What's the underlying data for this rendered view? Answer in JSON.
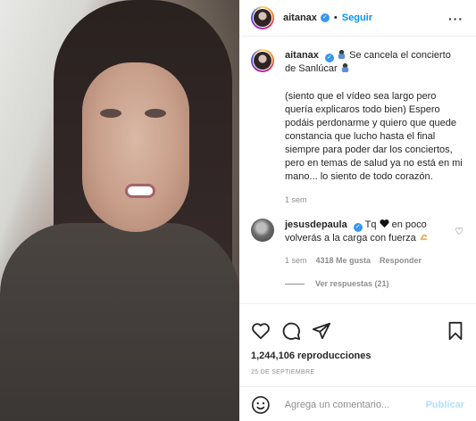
{
  "post": {
    "username": "aitanax",
    "follow_label": "Seguir",
    "more_label": "···"
  },
  "caption": {
    "username": "aitanax",
    "title_text": " Se cancela el concierto de Sanlúcar",
    "body": "(siento que el vídeo sea largo pero quería explicaros todo bien) Espero podáis perdonarme y quiero que quede constancia que lucho hasta el final siempre para poder dar los conciertos, pero en temas de salud ya no está en mi mano... lo siento de todo corazón.",
    "time": "1 sem"
  },
  "comment": {
    "username": "jesusdepaula",
    "text_before": " Tq ",
    "text_after": " en poco volverás a la carga con fuerza ",
    "time": "1 sem",
    "likes": "4318 Me gusta",
    "reply_label": "Responder",
    "view_replies": "Ver respuestas (21)"
  },
  "stats": {
    "views": "1,244,106 reproducciones",
    "date": "25 DE SEPTIEMBRE"
  },
  "add_comment": {
    "placeholder": "Agrega un comentario...",
    "publish_label": "Publicar"
  },
  "colors": {
    "accent": "#0095f6",
    "verified": "#3897f0",
    "publish_disabled": "#b2dffc",
    "muted": "#8e8e8e"
  },
  "icons": [
    "heart-icon",
    "comment-icon",
    "share-icon",
    "bookmark-icon",
    "emoji-icon",
    "verified-icon",
    "more-icon",
    "praying-emoji-icon",
    "black-heart-emoji-icon",
    "flexed-arm-emoji-icon"
  ]
}
